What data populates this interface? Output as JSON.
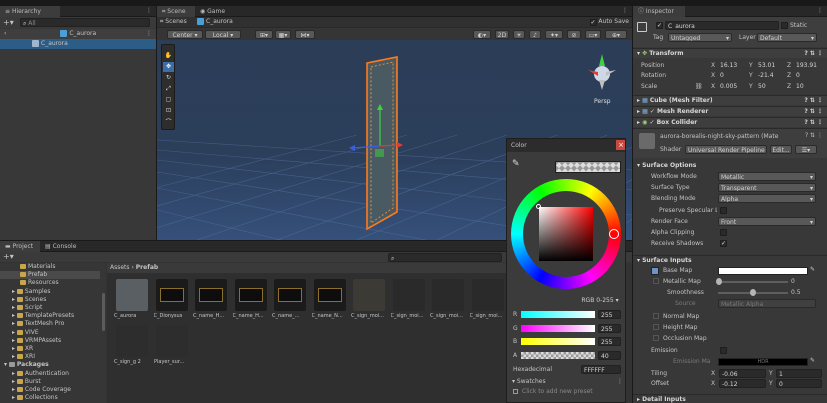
{
  "hierarchy": {
    "tab": "Hierarchy",
    "search_placeholder": "All",
    "scene_name": "C_aurora",
    "child_name": "C_aurora"
  },
  "scene": {
    "tabs": [
      "Scene",
      "Game"
    ],
    "breadcrumb_root": "Scenes",
    "breadcrumb_item": "C_aurora",
    "auto_save": "Auto Save",
    "pivot": "Center",
    "space": "Local",
    "mode_2d": "2D",
    "persp_label": "Persp"
  },
  "color_picker": {
    "title": "Color",
    "mode": "RGB 0-255",
    "channels": [
      {
        "label": "R",
        "value": "255"
      },
      {
        "label": "G",
        "value": "255"
      },
      {
        "label": "B",
        "value": "255"
      },
      {
        "label": "A",
        "value": "40"
      }
    ],
    "hex_label": "Hexadecimal",
    "hex_value": "FFFFFF",
    "swatches_label": "Swatches",
    "add_preset": "Click to add new preset"
  },
  "project": {
    "tabs": [
      "Project",
      "Console"
    ],
    "tree": [
      {
        "label": "Materials",
        "indent": 2
      },
      {
        "label": "Prefab",
        "indent": 2,
        "selected": true
      },
      {
        "label": "Resources",
        "indent": 2
      },
      {
        "label": "Samples",
        "indent": 1
      },
      {
        "label": "Scenes",
        "indent": 1
      },
      {
        "label": "Script",
        "indent": 1
      },
      {
        "label": "TemplatePresets",
        "indent": 1
      },
      {
        "label": "TextMesh Pro",
        "indent": 1
      },
      {
        "label": "VIVE",
        "indent": 1
      },
      {
        "label": "VRMPAssets",
        "indent": 1
      },
      {
        "label": "XR",
        "indent": 1
      },
      {
        "label": "XRI",
        "indent": 1
      },
      {
        "label": "Packages",
        "indent": 0,
        "bold": true
      },
      {
        "label": "Authentication",
        "indent": 1
      },
      {
        "label": "Burst",
        "indent": 1
      },
      {
        "label": "Code Coverage",
        "indent": 1
      },
      {
        "label": "Collections",
        "indent": 1
      }
    ],
    "path_root": "Assets",
    "path_item": "Prefab",
    "assets_row1": [
      "C_aurora",
      "C_Dionysus",
      "C_name_H...",
      "C_name_H...",
      "C_name_...",
      "C_name_N...",
      "C_sign_moi...",
      "C_sign_moi...",
      "C_sign_moi...",
      "C_sign_moi..."
    ],
    "assets_row2": [
      "C_sign_g 2",
      "Player_sur..."
    ]
  },
  "inspector": {
    "tab": "Inspector",
    "object_name": "C_aurora",
    "static_label": "Static",
    "tag_label": "Tag",
    "tag_value": "Untagged",
    "layer_label": "Layer",
    "layer_value": "Default",
    "transform": {
      "title": "Transform",
      "position": {
        "label": "Position",
        "x": "16.13",
        "y": "53.01",
        "z": "193.91"
      },
      "rotation": {
        "label": "Rotation",
        "x": "0",
        "y": "-21.4",
        "z": "0"
      },
      "scale": {
        "label": "Scale",
        "x": "0.005",
        "y": "50",
        "z": "10"
      }
    },
    "components": [
      "Cube (Mesh Filter)",
      "Mesh Renderer",
      "Box Collider"
    ],
    "material_name": "aurora-borealis-night-sky-pattern (Mate",
    "shader_label": "Shader",
    "shader_value": "Universal Render Pipeline",
    "edit_label": "Edit...",
    "surface_options": {
      "title": "Surface Options",
      "workflow": {
        "label": "Workflow Mode",
        "value": "Metallic"
      },
      "surface_type": {
        "label": "Surface Type",
        "value": "Transparent"
      },
      "blending": {
        "label": "Blending Mode",
        "value": "Alpha"
      },
      "preserve": {
        "label": "Preserve Specular L"
      },
      "render_face": {
        "label": "Render Face",
        "value": "Front"
      },
      "alpha_clip": {
        "label": "Alpha Clipping"
      },
      "receive_shadows": {
        "label": "Receive Shadows"
      }
    },
    "surface_inputs": {
      "title": "Surface Inputs",
      "base_map": "Base Map",
      "metallic_map": "Metallic Map",
      "metallic_value": "0",
      "smoothness": "Smoothness",
      "smoothness_value": "0.5",
      "source_label": "Source",
      "source_value": "Metallic Alpha",
      "normal_map": "Normal Map",
      "height_map": "Height Map",
      "occlusion_map": "Occlusion Map",
      "emission": "Emission",
      "emission_map": "Emission Ma",
      "hdr": "HDR",
      "tiling_label": "Tiling",
      "tiling_x": "-0.06",
      "tiling_y": "1",
      "offset_label": "Offset",
      "offset_x": "-0.12",
      "offset_y": "0"
    },
    "detail_inputs": "Detail Inputs"
  }
}
